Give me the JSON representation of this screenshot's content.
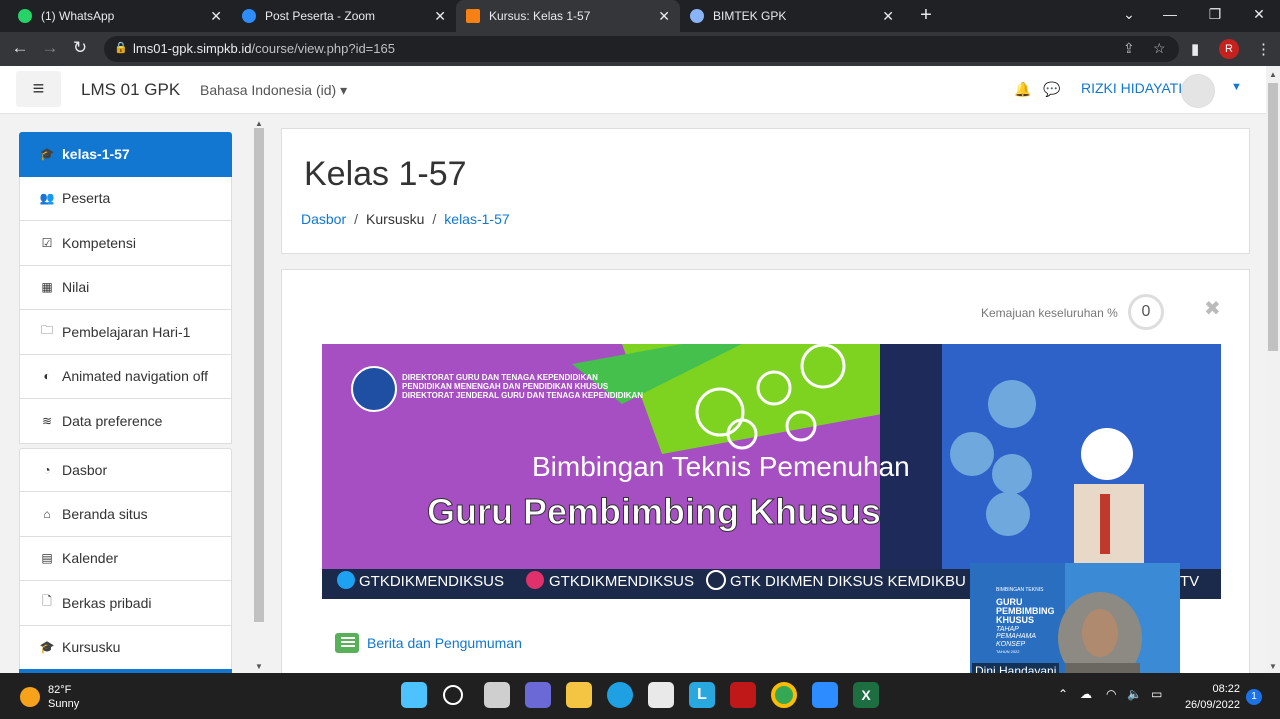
{
  "browser": {
    "tabs": [
      {
        "title": "(1) WhatsApp",
        "color": "#25d366"
      },
      {
        "title": "Post Peserta - Zoom",
        "color": "#2d8cff"
      },
      {
        "title": "Kursus: Kelas 1-57",
        "color": "#f98012"
      },
      {
        "title": "BIMTEK GPK",
        "color": "#8ab4f8"
      }
    ],
    "url_domain": "lms01-gpk.simpkb.id",
    "url_path": "/course/view.php?id=165",
    "profile_initial": "R"
  },
  "navbar": {
    "brand": "LMS 01 GPK",
    "language": "Bahasa Indonesia (id)",
    "user_name": "RIZKI HIDAYATI"
  },
  "sidebar": {
    "items": [
      {
        "label": "kelas-1-57",
        "icon": "graduation-cap-icon"
      },
      {
        "label": "Peserta",
        "icon": "users-icon"
      },
      {
        "label": "Kompetensi",
        "icon": "check-square-icon"
      },
      {
        "label": "Nilai",
        "icon": "table-icon"
      },
      {
        "label": "Pembelajaran Hari-1",
        "icon": "folder-icon"
      },
      {
        "label": "Animated navigation off",
        "icon": "toggle-off-icon"
      },
      {
        "label": "Data preference",
        "icon": "database-icon"
      },
      {
        "label": "Dasbor",
        "icon": "dashboard-icon"
      },
      {
        "label": "Beranda situs",
        "icon": "home-icon"
      },
      {
        "label": "Kalender",
        "icon": "calendar-icon"
      },
      {
        "label": "Berkas pribadi",
        "icon": "file-icon"
      },
      {
        "label": "Kursusku",
        "icon": "graduation-cap-icon"
      }
    ]
  },
  "course": {
    "title": "Kelas 1-57",
    "breadcrumb": [
      "Dasbor",
      "Kursusku",
      "kelas-1-57"
    ],
    "progress_label": "Kemajuan keseluruhan %",
    "progress_value": "0"
  },
  "banner": {
    "org_line1": "DIREKTORAT GURU DAN TENAGA KEPENDIDIKAN",
    "org_line2": "PENDIDIKAN MENENGAH DAN PENDIDIKAN KHUSUS",
    "org_line3": "DIREKTORAT JENDERAL GURU DAN TENAGA KEPENDIDIKAN",
    "subtitle": "Bimbingan Teknis Pemenuhan",
    "title": "Guru Pembimbing Khusus",
    "social_twitter": "GTKDIKMENDIKSUS",
    "social_instagram": "GTKDIKMENDIKSUS",
    "social_facebook": "GTK DIKMEN DIKSUS KEMDIKBU",
    "social_tail": "TV"
  },
  "news": {
    "label": "Berita dan Pengumuman"
  },
  "zoom_video": {
    "participant": "Dini Handayani",
    "slide_lines": [
      "BIMBINGAN TEKNIS",
      "GURU",
      "PEMBIMBING",
      "KHUSUS",
      "TAHAP",
      "PEMAHAMA",
      "KONSEP",
      "TAHUN 2022"
    ]
  },
  "taskbar": {
    "temperature": "82°F",
    "weather": "Sunny",
    "time": "08:22",
    "date": "26/09/2022",
    "notifications": "1",
    "apps": [
      {
        "name": "start-icon",
        "color": "#4cc2ff"
      },
      {
        "name": "search-icon",
        "color": "#202020"
      },
      {
        "name": "task-view-icon",
        "color": "#cfcfcf"
      },
      {
        "name": "teams-chat-icon",
        "color": "#6b69d6"
      },
      {
        "name": "file-explorer-icon",
        "color": "#f4c542"
      },
      {
        "name": "edge-icon",
        "color": "#1fa0e3"
      },
      {
        "name": "store-icon",
        "color": "#e9e9e9"
      },
      {
        "name": "lms-l-icon",
        "color": "#29a8e0"
      },
      {
        "name": "mcafee-icon",
        "color": "#c01818"
      },
      {
        "name": "chrome-icon",
        "color": "#34a853"
      },
      {
        "name": "zoom-icon",
        "color": "#2d8cff"
      },
      {
        "name": "excel-icon",
        "color": "#1d6f42"
      }
    ]
  }
}
